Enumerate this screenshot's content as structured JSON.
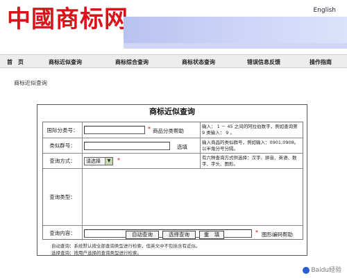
{
  "header": {
    "logo_text": "中國商标网",
    "english_link": "English"
  },
  "nav": {
    "items": [
      {
        "label": "首　页"
      },
      {
        "label": "商标近似查询"
      },
      {
        "label": "商标综合查询"
      },
      {
        "label": "商标状态查询"
      },
      {
        "label": "错误信息反馈"
      },
      {
        "label": "操作指南"
      }
    ]
  },
  "breadcrumb": "商标近似查询",
  "panel": {
    "title": "商标近似查询",
    "rows": {
      "class_no": {
        "label": "国际分类号：",
        "value": "",
        "help_link": "商品分类帮助",
        "hint": "输入： 1 － 45 之间的阿拉伯数字，例如查询第 9 类输入： 9 。"
      },
      "group_no": {
        "label": "类似群号：",
        "value": "",
        "select_link": "选填",
        "hint": "输入商品的类似群号，例如输入：0901;0908。以半角分号分隔。"
      },
      "query_mode": {
        "label": "查询方式：",
        "select_value": "请选择",
        "hint": "有六种查询方式供选择：汉字、拼音、英语、数字、字头、图形。"
      },
      "query_type": {
        "label": "查询类型："
      },
      "query_content": {
        "label": "查询内容：",
        "value": "",
        "help_link": "图形编码帮助"
      }
    },
    "buttons": {
      "auto": "自动查询",
      "select": "选择查询",
      "reset": "重　填"
    },
    "notes": [
      "自动查询：系统默认按全部查询类型进行检索，但英文中不包括含有近似。",
      "选择查询：按用户选择的查询类型进行检索。"
    ]
  },
  "watermark": "Baidu经验"
}
